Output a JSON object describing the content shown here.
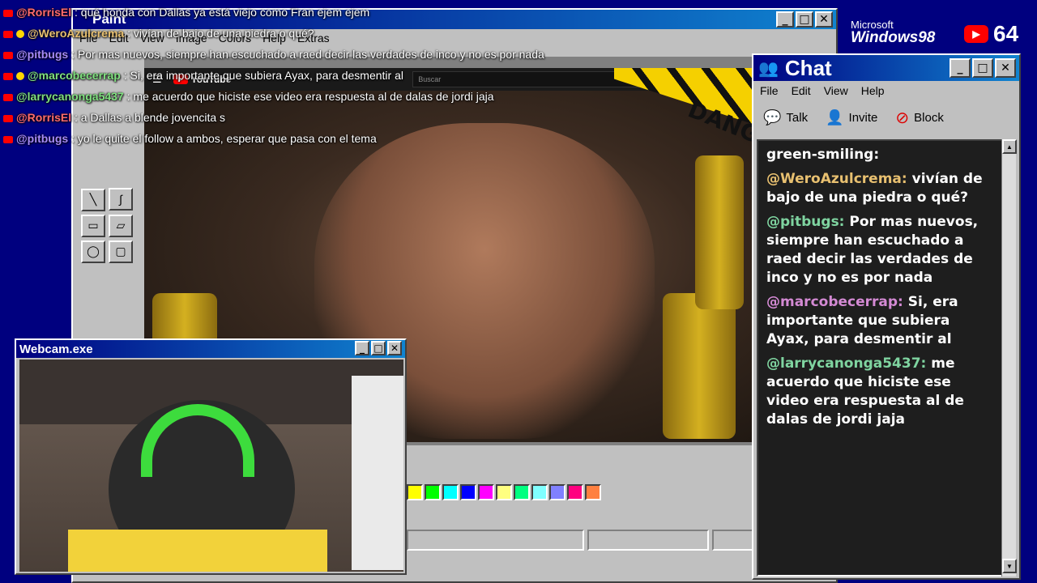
{
  "paint": {
    "title": "Paint",
    "menu": [
      "File",
      "Edit",
      "View",
      "Image",
      "Colors",
      "Help",
      "Extras"
    ],
    "palette": [
      "#ffff00",
      "#00ff00",
      "#00ffff",
      "#0000ff",
      "#ff00ff",
      "#ffff80",
      "#00ff80",
      "#80ffff",
      "#8080ff",
      "#ff0080",
      "#ff8040"
    ],
    "tools": [
      "line-tool",
      "curve-tool",
      "rectangle-tool",
      "polygon-tool",
      "ellipse-tool",
      "rounded-rect-tool"
    ]
  },
  "youtube": {
    "logo": "YouTube",
    "search_placeholder": "Buscar",
    "danger_text": "DANGER"
  },
  "webcam": {
    "title": "Webcam.exe"
  },
  "chat": {
    "title": "Chat",
    "menu": [
      "File",
      "Edit",
      "View",
      "Help"
    ],
    "tools": [
      {
        "label": "Talk"
      },
      {
        "label": "Invite"
      },
      {
        "label": "Block"
      }
    ],
    "messages": [
      {
        "user": "",
        "text": "green-smiling:",
        "color": "#ffffff"
      },
      {
        "user": "@WeroAzulcrema:",
        "text": "vivían de bajo de una piedra o qué?",
        "color": "#e8c070"
      },
      {
        "user": "@pitbugs:",
        "text": "Por mas nuevos, siempre han escuchado a raed decir las verdades de inco y no es por nada",
        "color": "#7fd4a0"
      },
      {
        "user": "@marcobecerrap:",
        "text": "Si, era importante que subiera Ayax, para desmentir al",
        "color": "#d48ad4"
      },
      {
        "user": "@larrycanonga5437:",
        "text": "me acuerdo que hiciste ese video era respuesta al de dalas de jordi jaja",
        "color": "#7fd4a0"
      }
    ]
  },
  "branding": {
    "ms_line": "Microsoft",
    "win_line": "Windows98",
    "yt_count": "64"
  },
  "overlay": [
    {
      "user": "@RorrisEl",
      "text": "qué honda con Dallas ya está viejo como Fran ejem ejem",
      "color": "#ff6b6b",
      "badge": false
    },
    {
      "user": "@WeroAzulcrema",
      "text": "vivían de bajo de una piedra o qué?",
      "color": "#e8c070",
      "badge": true
    },
    {
      "user": "@pitbugs",
      "text": "Por mas nuevos, siempre han escuchado a raed decir las verdades de inco y no es por nada",
      "color": "#a78bfa",
      "badge": false
    },
    {
      "user": "@marcobecerrap",
      "text": "Si, era importante que subiera Ayax, para desmentir al",
      "color": "#7fe07f",
      "badge": true
    },
    {
      "user": "@larrycanonga5437",
      "text": "me acuerdo que hiciste ese video era respuesta al de dalas de jordi jaja",
      "color": "#7fe07f",
      "badge": false
    },
    {
      "user": "@RorrisEl",
      "text": "a Dallas a blende jovencita s",
      "color": "#ff6b6b",
      "badge": false
    },
    {
      "user": "@pitbugs",
      "text": "yo le quite el follow a ambos, esperar que pasa con el tema",
      "color": "#a78bfa",
      "badge": false
    }
  ]
}
